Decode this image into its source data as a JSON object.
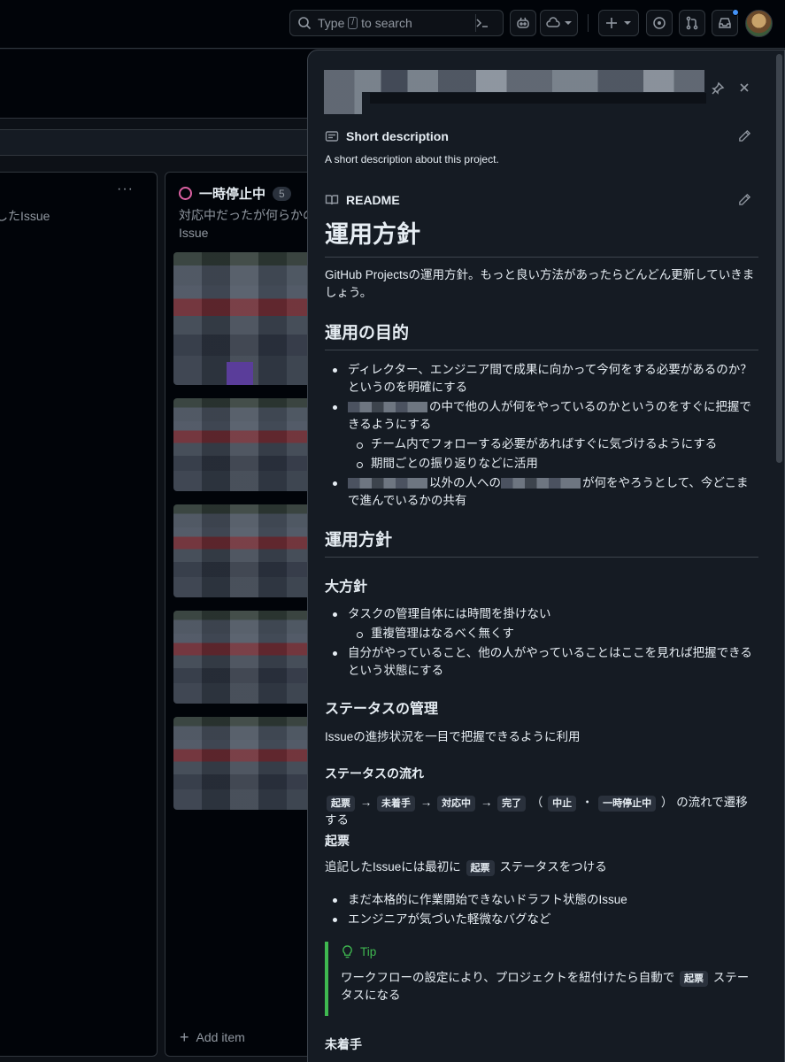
{
  "header": {
    "search_prefix": "Type",
    "search_key": "/",
    "search_suffix": "to search"
  },
  "board": {
    "column1_desc": "したIssue",
    "column2": {
      "title": "一時停止中",
      "count": "5",
      "desc_line1": "対応中だったが何らかの",
      "desc_line2": "Issue"
    },
    "add_item": "Add item"
  },
  "panel": {
    "short_description_label": "Short description",
    "short_description_text": "A short description about this project.",
    "readme_label": "README",
    "readme": {
      "h1": "運用方針",
      "intro": "GitHub Projectsの運用方針。もっと良い方法があったらどんどん更新していきましょう。",
      "h2_purpose": "運用の目的",
      "purpose_1": "ディレクター、エンジニア間で成果に向かって今何をする必要があるのか？というのを明確にする",
      "purpose_2_suffix": "の中で他の人が何をやっているのかというのをすぐに把握できるようにする",
      "purpose_2_sub1": "チーム内でフォローする必要があればすぐに気づけるようにする",
      "purpose_2_sub2": "期間ごとの振り返りなどに活用",
      "purpose_3_mid": "以外の人への",
      "purpose_3_suffix": "が何をやろうとして、今どこまで進んでいるかの共有",
      "h2_policy": "運用方針",
      "h3_overall": "大方針",
      "overall_1": "タスクの管理自体には時間を掛けない",
      "overall_1_sub": "重複管理はなるべく無くす",
      "overall_2": "自分がやっていること、他の人がやっていることはここを見れば把握できるという状態にする",
      "h3_status": "ステータスの管理",
      "status_intro": "Issueの進捗状況を一目で把握できるように利用",
      "h4_flow": "ステータスの流れ",
      "flow": {
        "s1": "起票",
        "arrow": "→",
        "s2": "未着手",
        "s3": "対応中",
        "s4": "完了",
        "paren_open": "（",
        "s5": "中止",
        "dot": "・",
        "s6": "一時停止中",
        "paren_close": "）",
        "suffix": "の流れで遷移する"
      },
      "h4_draft": "起票",
      "draft_prefix": "追記したIssueには最初に",
      "draft_code": "起票",
      "draft_suffix": "ステータスをつける",
      "draft_1": "まだ本格的に作業開始できないドラフト状態のIssue",
      "draft_2": "エンジニアが気づいた軽微なバグなど",
      "tip_label": "Tip",
      "tip_prefix": "ワークフローの設定により、プロジェクトを紐付けたら自動で",
      "tip_code": "起票",
      "tip_suffix": "ステータスになる",
      "h4_todo": "未着手"
    }
  },
  "colors": {
    "accent_green": "#3fb950",
    "paused_pink": "#db61a2",
    "notification_blue": "#4493f8"
  }
}
